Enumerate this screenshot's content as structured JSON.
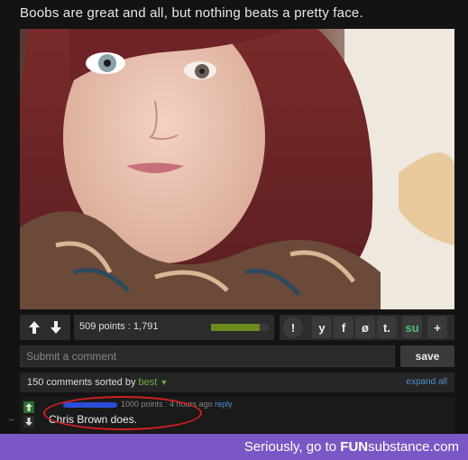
{
  "post": {
    "title": "Boobs are great and all, but nothing beats a pretty face."
  },
  "toolbar": {
    "points_text": "509 points : 1,791",
    "vote_ratio": 0.85,
    "report_label": "!",
    "twitter_label": "y",
    "facebook_label": "f",
    "stumble_label": "ø",
    "tumblr_label": "t.",
    "su_label": "su",
    "plus_label": "+"
  },
  "comment_box": {
    "placeholder": "Submit a comment",
    "save_label": "save"
  },
  "comments_bar": {
    "count_text": "150 comments sorted by",
    "sort_value": "best",
    "expand_label": "expand all"
  },
  "comment": {
    "points_time": "1000 points : 4 hours ago",
    "reply_label": "reply",
    "text": "Chris Brown does."
  },
  "footer": {
    "prefix": "Seriously, go to ",
    "brand_bold": "FUN",
    "brand_rest": "substance.com"
  },
  "colors": {
    "vote_bar": "#6b8b1f",
    "footer_bg": "#7a57c4",
    "link": "#4f8fcf",
    "highlight_circle": "#d42020"
  }
}
